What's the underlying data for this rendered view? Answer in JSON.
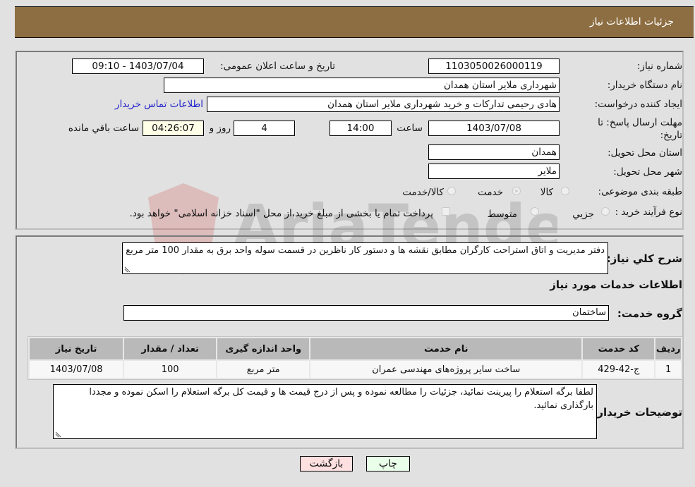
{
  "header": {
    "title": "جزئیات اطلاعات نیاز"
  },
  "fields": {
    "need_number": {
      "label": "شماره نیاز:",
      "value": "1103050026000119"
    },
    "announce_datetime": {
      "label": "تاریخ و ساعت اعلان عمومی:",
      "value": "1403/07/04 - 09:10"
    },
    "buyer_org": {
      "label": "نام دستگاه خریدار:",
      "value": "شهرداری ملایر استان همدان"
    },
    "requester": {
      "label": "ایجاد کننده درخواست:",
      "value": "هادی رحیمی تدارکات و خرید شهرداری ملایر استان همدان"
    },
    "buyer_contact_link": "اطلاعات تماس خریدار",
    "deadline": {
      "label": "مهلت ارسال پاسخ: تا تاریخ:",
      "date": "1403/07/08",
      "time_label": "ساعت",
      "time": "14:00",
      "days": "4",
      "days_label": "روز و",
      "remaining": "04:26:07",
      "remaining_label": "ساعت باقي مانده"
    },
    "province": {
      "label": "استان محل تحویل:",
      "value": "همدان"
    },
    "city": {
      "label": "شهر محل تحویل:",
      "value": "ملایر"
    },
    "category": {
      "label": "طبقه بندی موضوعی:",
      "options": [
        {
          "label": "کالا",
          "selected": false
        },
        {
          "label": "خدمت",
          "selected": true
        },
        {
          "label": "کالا/خدمت",
          "selected": false
        }
      ]
    },
    "purchase_type": {
      "label": "نوع فرآیند خرید :",
      "options": [
        {
          "label": "جزيي",
          "selected": false
        },
        {
          "label": "متوسط",
          "selected": false
        }
      ],
      "treasury_checkbox_label": "پرداخت تمام یا بخشی از مبلغ خرید،از محل \"اسناد خزانه اسلامی\" خواهد بود.",
      "treasury_checked": false
    }
  },
  "description": {
    "label": "شرح كلي نياز:",
    "value": "دفتر مدیریت و اتاق استراحت کارگران مطابق نقشه ها و دستور کار ناظرین در قسمت سوله واحد برق به مقدار 100 متر مربع"
  },
  "services_section_title": "اطلاعات خدمات مورد نیاز",
  "service_group": {
    "label": "گروه خدمت:",
    "value": "ساختمان"
  },
  "table": {
    "columns": [
      "ردیف",
      "کد خدمت",
      "نام خدمت",
      "واحد اندازه گیری",
      "تعداد / مقدار",
      "تاریخ نیاز"
    ],
    "rows": [
      [
        "1",
        "ج-42-429",
        "ساخت سایر پروژه‌های مهندسی عمران",
        "متر مربع",
        "100",
        "1403/07/08"
      ]
    ]
  },
  "buyer_notes": {
    "label": "توضیحات خریدار:",
    "value": "لطفا برگه استعلام را پیرینت نمائید، جزئیات را مطالعه نموده و پس از درج قیمت ها و قیمت کل برگه استعلام را اسکن نموده و مجددا بارگذاری نمائید."
  },
  "buttons": {
    "print": "چاپ",
    "back": "بازگشت"
  },
  "colors": {
    "header_bg": "#8d6e42",
    "print_bg": "#eaffea",
    "back_bg": "#ffe0e0",
    "link": "#2222cc"
  },
  "watermark": "AriaTender.neT"
}
